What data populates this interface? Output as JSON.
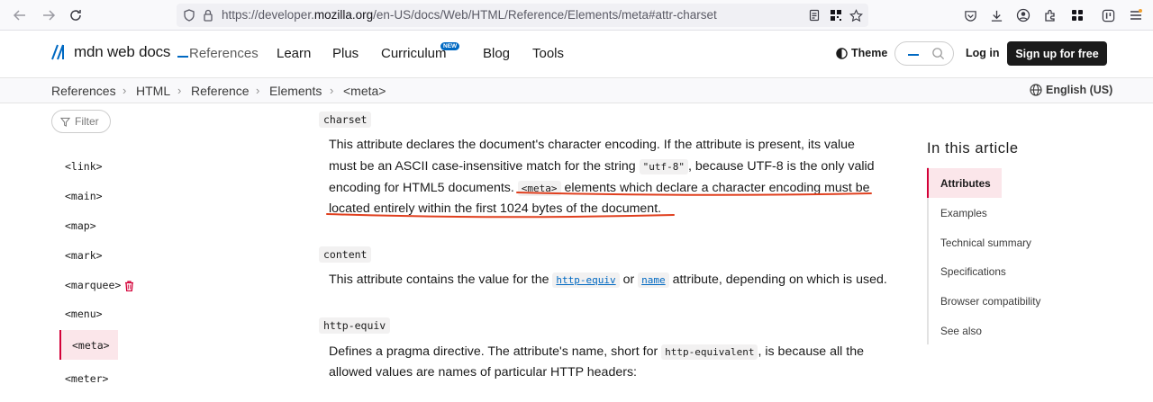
{
  "browser": {
    "url_prefix": "https://developer.",
    "url_domain": "mozilla.org",
    "url_suffix": "/en-US/docs/Web/HTML/Reference/Elements/meta#attr-charset"
  },
  "header": {
    "logo": "mdn web docs",
    "nav": [
      "References",
      "Learn",
      "Plus",
      "Curriculum",
      "Blog",
      "Tools"
    ],
    "new_badge": "NEW",
    "theme": "Theme",
    "login": "Log in",
    "signup": "Sign up for free"
  },
  "breadcrumb": [
    "References",
    "HTML",
    "Reference",
    "Elements",
    "<meta>"
  ],
  "language": "English (US)",
  "sidebar": {
    "filter": "Filter",
    "items": [
      "<link>",
      "<main>",
      "<map>",
      "<mark>",
      "<marquee>",
      "<menu>",
      "<meta>",
      "<meter>"
    ]
  },
  "article": {
    "charset_term": "charset",
    "charset_p1": "This attribute declares the document's character encoding. If the attribute is present, its value",
    "charset_p2a": "must be an ASCII case-insensitive match for the string ",
    "charset_p2_code": "\"utf-8\"",
    "charset_p2b": ", because UTF-8 is the only valid",
    "charset_p3a": "encoding for HTML5 documents. ",
    "charset_p3_code": "<meta>",
    "charset_p3b": " elements which declare a character encoding must be",
    "charset_p4": "located entirely within the first 1024 bytes of the document.",
    "content_term": "content",
    "content_pa": "This attribute contains the value for the ",
    "content_link1": "http-equiv",
    "content_pb": " or ",
    "content_link2": "name",
    "content_pc": " attribute, depending on which is used.",
    "httpequiv_term": "http-equiv",
    "httpequiv_p1a": "Defines a pragma directive. The attribute's name, short for ",
    "httpequiv_p1_code": "http-equivalent",
    "httpequiv_p1b": ", is because all the",
    "httpequiv_p2": "allowed values are names of particular HTTP headers:"
  },
  "toc": {
    "title": "In this article",
    "items": [
      "Attributes",
      "Examples",
      "Technical summary",
      "Specifications",
      "Browser compatibility",
      "See also"
    ]
  },
  "colors": {
    "accent": "#0069c2",
    "highlight_bg": "#fbe6ea",
    "highlight_border": "#d30038",
    "annotation": "#e0401f"
  }
}
